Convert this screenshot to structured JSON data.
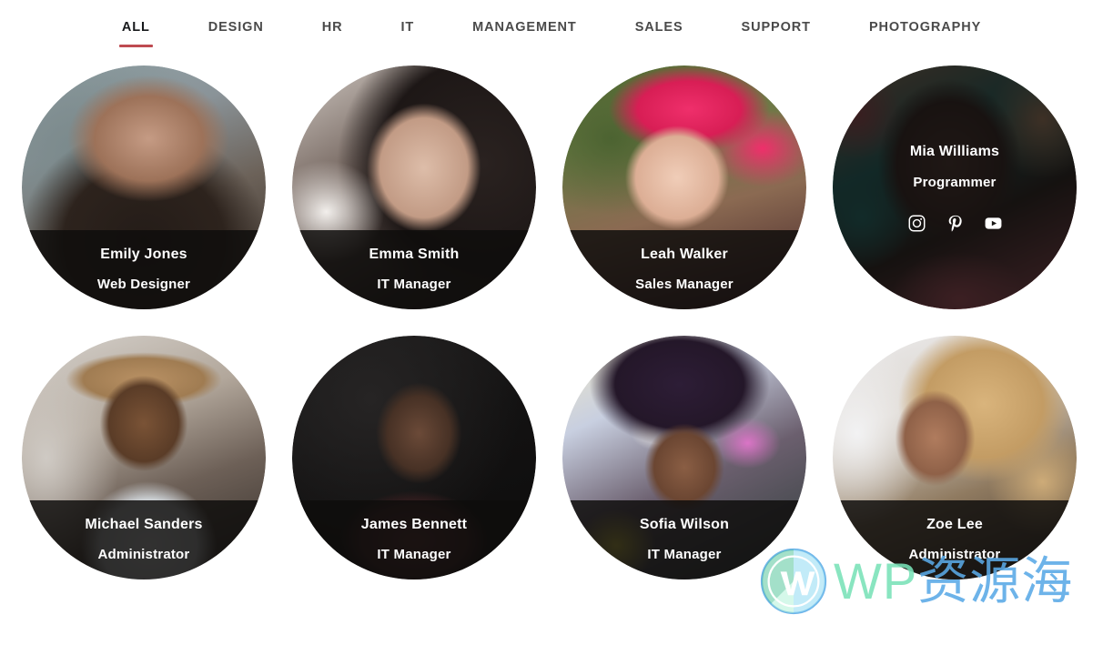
{
  "theme": {
    "accent": "#be4b51",
    "tab_inactive_color": "#4a4a4a",
    "tab_active_color": "#17191c",
    "overlay_color": "rgba(14,13,12,0.84)",
    "text_color": "#ffffff",
    "background": "#ffffff"
  },
  "filter_nav": {
    "tabs": [
      {
        "label": "ALL",
        "active": true
      },
      {
        "label": "DESIGN",
        "active": false
      },
      {
        "label": "HR",
        "active": false
      },
      {
        "label": "IT",
        "active": false
      },
      {
        "label": "MANAGEMENT",
        "active": false
      },
      {
        "label": "SALES",
        "active": false
      },
      {
        "label": "SUPPORT",
        "active": false
      },
      {
        "label": "PHOTOGRAPHY",
        "active": false
      }
    ]
  },
  "team": {
    "members": [
      {
        "name": "Emily Jones",
        "role": "Web Designer",
        "photo_class": "photo-emily",
        "hovered": false,
        "socials": []
      },
      {
        "name": "Emma Smith",
        "role": "IT Manager",
        "photo_class": "photo-emma",
        "hovered": false,
        "socials": []
      },
      {
        "name": "Leah Walker",
        "role": "Sales Manager",
        "photo_class": "photo-leah",
        "hovered": false,
        "socials": []
      },
      {
        "name": "Mia Williams",
        "role": "Programmer",
        "photo_class": "photo-mia",
        "hovered": true,
        "socials": [
          "instagram-icon",
          "pinterest-icon",
          "youtube-icon"
        ]
      },
      {
        "name": "Michael Sanders",
        "role": "Administrator",
        "photo_class": "photo-michael",
        "hovered": false,
        "socials": []
      },
      {
        "name": "James Bennett",
        "role": "IT Manager",
        "photo_class": "photo-james",
        "hovered": false,
        "socials": []
      },
      {
        "name": "Sofia Wilson",
        "role": "IT Manager",
        "photo_class": "photo-sofia",
        "hovered": false,
        "socials": []
      },
      {
        "name": "Zoe Lee",
        "role": "Administrator",
        "photo_class": "photo-zoe",
        "hovered": false,
        "socials": []
      }
    ]
  },
  "watermark": {
    "logo_icon": "wordpress-logo-icon",
    "text_latin": "WP",
    "text_cjk": "资源海",
    "color_latin": "#79e2b8",
    "color_cjk": "#5aa9e6"
  }
}
